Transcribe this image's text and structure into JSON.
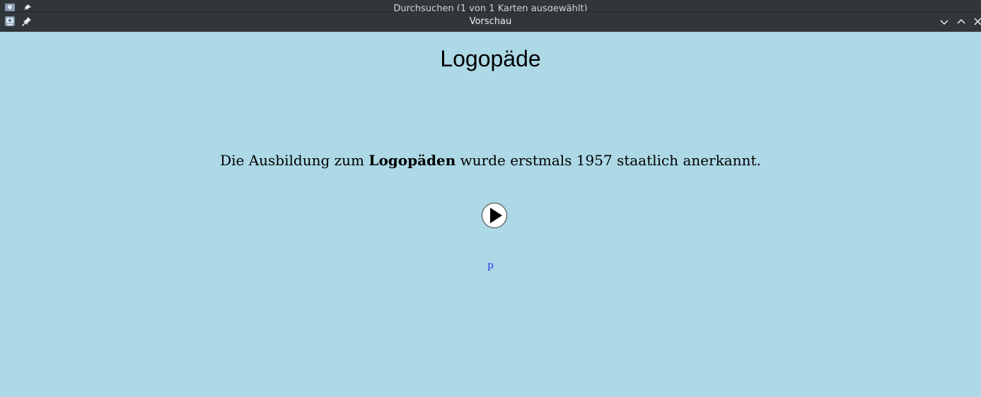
{
  "background_window": {
    "title": "Durchsuchen (1 von 1 Karten ausgewählt)"
  },
  "window": {
    "title": "Vorschau",
    "icons": {
      "app": "anki-icon",
      "pin": "pin-icon",
      "minimize": "chevron-down-icon",
      "maximize": "chevron-up-icon",
      "close": "close-icon"
    }
  },
  "card": {
    "title": "Logopäde",
    "sentence_before": "Die Ausbildung zum ",
    "sentence_bold": "Logopäden",
    "sentence_after": " wurde erstmals 1957 staatlich anerkannt.",
    "audio_icon": "play-icon",
    "link_text": "p"
  },
  "colors": {
    "background": "#add8e6",
    "titlebar": "#31363b",
    "link": "#3333ee"
  }
}
